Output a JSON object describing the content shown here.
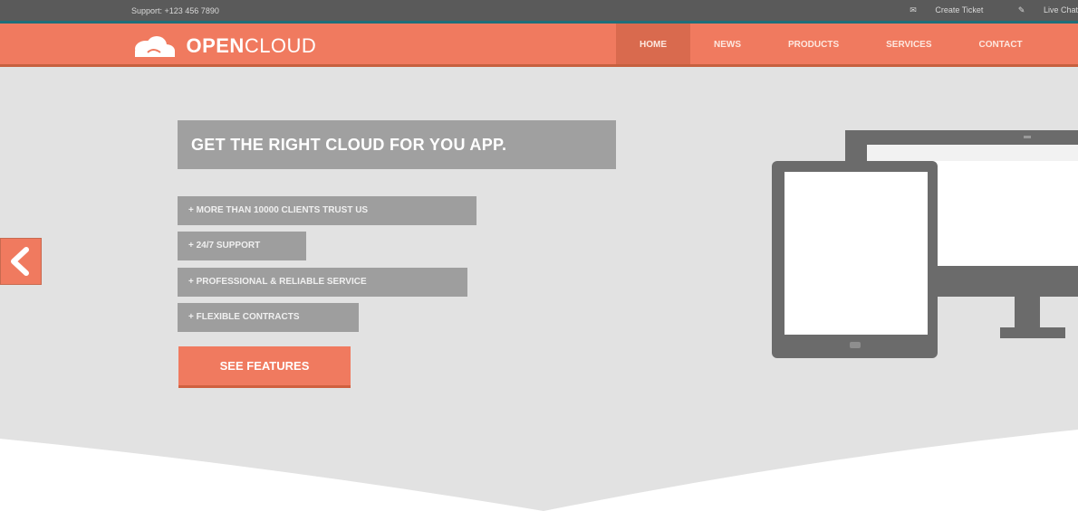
{
  "topbar": {
    "contact": "Support: +123 456 7890",
    "links": [
      "Create Ticket",
      "Live Chat"
    ]
  },
  "logo": {
    "brand": "OPEN",
    "suffix": "CLOUD"
  },
  "nav": {
    "items": [
      {
        "label": "HOME",
        "active": true
      },
      {
        "label": "NEWS",
        "active": false
      },
      {
        "label": "PRODUCTS",
        "active": false
      },
      {
        "label": "SERVICES",
        "active": false
      },
      {
        "label": "CONTACT",
        "active": false
      }
    ]
  },
  "hero": {
    "headline": "GET THE RIGHT CLOUD FOR YOU APP.",
    "features": [
      "+ MORE THAN 10000 CLIENTS TRUST US",
      "+ 24/7 SUPPORT",
      "+ PROFESSIONAL & RELIABLE SERVICE",
      "+ FLEXIBLE CONTRACTS"
    ],
    "cta": "SEE FEATURES"
  },
  "colors": {
    "accent": "#f07a5f",
    "topbar": "#5a5a5a",
    "hero_bg": "#e2e2e2",
    "box_gray": "#a0a0a0",
    "device": "#6b6b6b"
  },
  "icons": [
    "cloud-logo-icon",
    "chevron-left-icon",
    "tablet-icon",
    "monitor-icon",
    "envelope-icon",
    "chat-icon"
  ]
}
